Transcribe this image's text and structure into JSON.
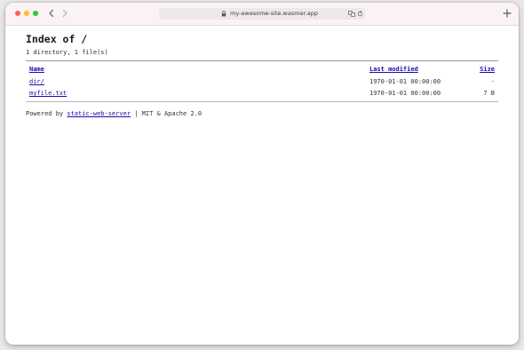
{
  "browser": {
    "url": "my-awesome-site.wasmer.app",
    "traffic_lights": {
      "close": "#ff5f57",
      "minimize": "#febc2e",
      "zoom": "#28c840"
    }
  },
  "page": {
    "title": "Index of /",
    "summary": "1 directory, 1 file(s)",
    "columns": {
      "name": "Name",
      "modified": "Last modified",
      "size": "Size"
    },
    "entries": [
      {
        "name": "dir/",
        "modified": "1970-01-01 00:00:00",
        "size": "-"
      },
      {
        "name": "myfile.txt",
        "modified": "1970-01-01 00:00:00",
        "size": "7 B"
      }
    ],
    "footer": {
      "prefix": "Powered by ",
      "link": "static-web-server",
      "suffix": " | MIT & Apache 2.0"
    },
    "link_color": "#1a0dab"
  }
}
